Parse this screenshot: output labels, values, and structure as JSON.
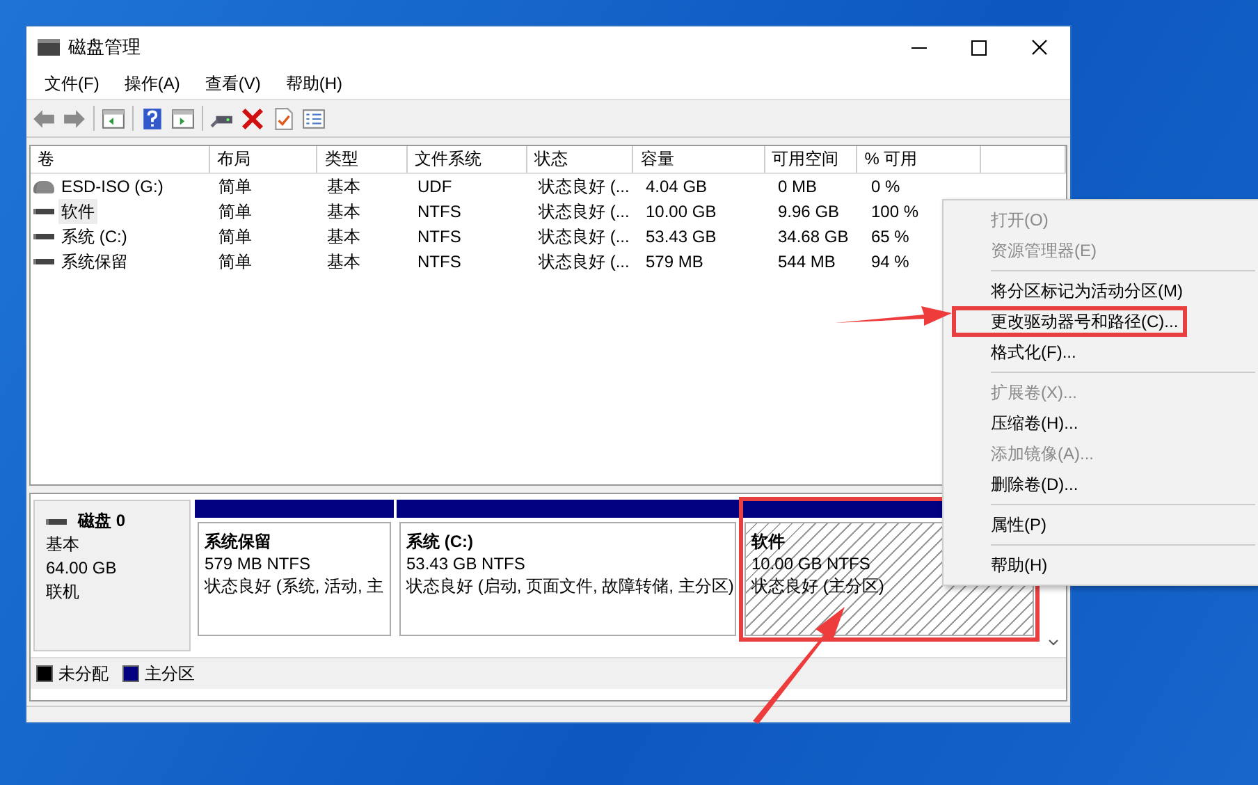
{
  "window": {
    "title": "磁盘管理"
  },
  "menu_bar": [
    "文件(F)",
    "操作(A)",
    "查看(V)",
    "帮助(H)"
  ],
  "toolbar": [
    {
      "kind": "back"
    },
    {
      "kind": "forward"
    },
    {
      "kind": "sep"
    },
    {
      "kind": "console"
    },
    {
      "kind": "sep"
    },
    {
      "kind": "help"
    },
    {
      "kind": "panel"
    },
    {
      "kind": "sep"
    },
    {
      "kind": "connect"
    },
    {
      "kind": "delete"
    },
    {
      "kind": "properties"
    },
    {
      "kind": "list"
    }
  ],
  "table": {
    "columns": [
      "卷",
      "布局",
      "类型",
      "文件系统",
      "状态",
      "容量",
      "可用空间",
      "% 可用"
    ],
    "rows": [
      {
        "selected": false,
        "cells": [
          "ESD-ISO (G:)",
          "简单",
          "基本",
          "UDF",
          "状态良好 (...",
          "4.04 GB",
          "0 MB",
          "0 %"
        ]
      },
      {
        "selected": true,
        "cells": [
          "软件",
          "简单",
          "基本",
          "NTFS",
          "状态良好 (...",
          "10.00 GB",
          "9.96 GB",
          "100 %"
        ]
      },
      {
        "selected": false,
        "cells": [
          "系统 (C:)",
          "简单",
          "基本",
          "NTFS",
          "状态良好 (...",
          "53.43 GB",
          "34.68 GB",
          "65 %"
        ]
      },
      {
        "selected": false,
        "cells": [
          "系统保留",
          "简单",
          "基本",
          "NTFS",
          "状态良好 (...",
          "579 MB",
          "544 MB",
          "94 %"
        ]
      }
    ]
  },
  "disk": {
    "name": "磁盘 0",
    "type": "基本",
    "size": "64.00 GB",
    "status": "联机",
    "partitions": [
      {
        "name": "系统保留",
        "size": "579 MB NTFS",
        "status": "状态良好 (系统, 活动, 主",
        "selected": false,
        "annotated": false
      },
      {
        "name": "系统  (C:)",
        "size": "53.43 GB NTFS",
        "status": "状态良好 (启动, 页面文件, 故障转储, 主分区)",
        "selected": false,
        "annotated": false
      },
      {
        "name": "软件",
        "size": "10.00 GB NTFS",
        "status": "状态良好 (主分区)",
        "selected": true,
        "annotated": true
      }
    ]
  },
  "legend": [
    {
      "label": "未分配",
      "color": "#000000"
    },
    {
      "label": "主分区",
      "color": "#000080"
    }
  ],
  "context_menu": [
    {
      "kind": "item",
      "label": "打开(O)",
      "disabled": true,
      "annotated": false
    },
    {
      "kind": "item",
      "label": "资源管理器(E)",
      "disabled": true,
      "annotated": false
    },
    {
      "kind": "separator"
    },
    {
      "kind": "item",
      "label": "将分区标记为活动分区(M)",
      "disabled": false,
      "annotated": false
    },
    {
      "kind": "item",
      "label": "更改驱动器号和路径(C)...",
      "disabled": false,
      "annotated": true
    },
    {
      "kind": "item",
      "label": "格式化(F)...",
      "disabled": false,
      "annotated": false
    },
    {
      "kind": "separator"
    },
    {
      "kind": "item",
      "label": "扩展卷(X)...",
      "disabled": true,
      "annotated": false
    },
    {
      "kind": "item",
      "label": "压缩卷(H)...",
      "disabled": false,
      "annotated": false
    },
    {
      "kind": "item",
      "label": "添加镜像(A)...",
      "disabled": true,
      "annotated": false
    },
    {
      "kind": "item",
      "label": "删除卷(D)...",
      "disabled": false,
      "annotated": false
    },
    {
      "kind": "separator"
    },
    {
      "kind": "item",
      "label": "属性(P)",
      "disabled": false,
      "annotated": false
    },
    {
      "kind": "separator"
    },
    {
      "kind": "item",
      "label": "帮助(H)",
      "disabled": false,
      "annotated": false
    }
  ]
}
